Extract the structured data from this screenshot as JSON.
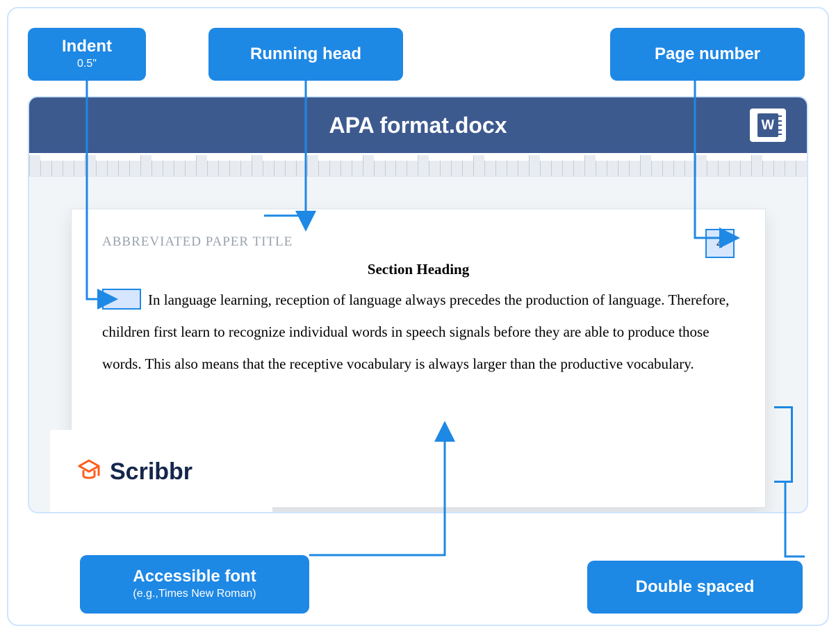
{
  "labels": {
    "indent": {
      "title": "Indent",
      "sub": "0.5\""
    },
    "running_head": {
      "title": "Running head"
    },
    "page_number": {
      "title": "Page number"
    },
    "accessible_font": {
      "title": "Accessible font",
      "sub": "(e.g.,Times New Roman)"
    },
    "double_spaced": {
      "title": "Double spaced"
    }
  },
  "document": {
    "filename": "APA format.docx",
    "running_head": "ABBREVIATED PAPER TITLE",
    "page_number": "4",
    "section_heading": "Section Heading",
    "body": "In language learning, reception of language always precedes the production of language. Therefore, children first learn to recognize individual words in speech signals before they are able to produce those words. This also means that the receptive vocabulary is always larger than the productive vocabulary."
  },
  "brand": "Scribbr"
}
